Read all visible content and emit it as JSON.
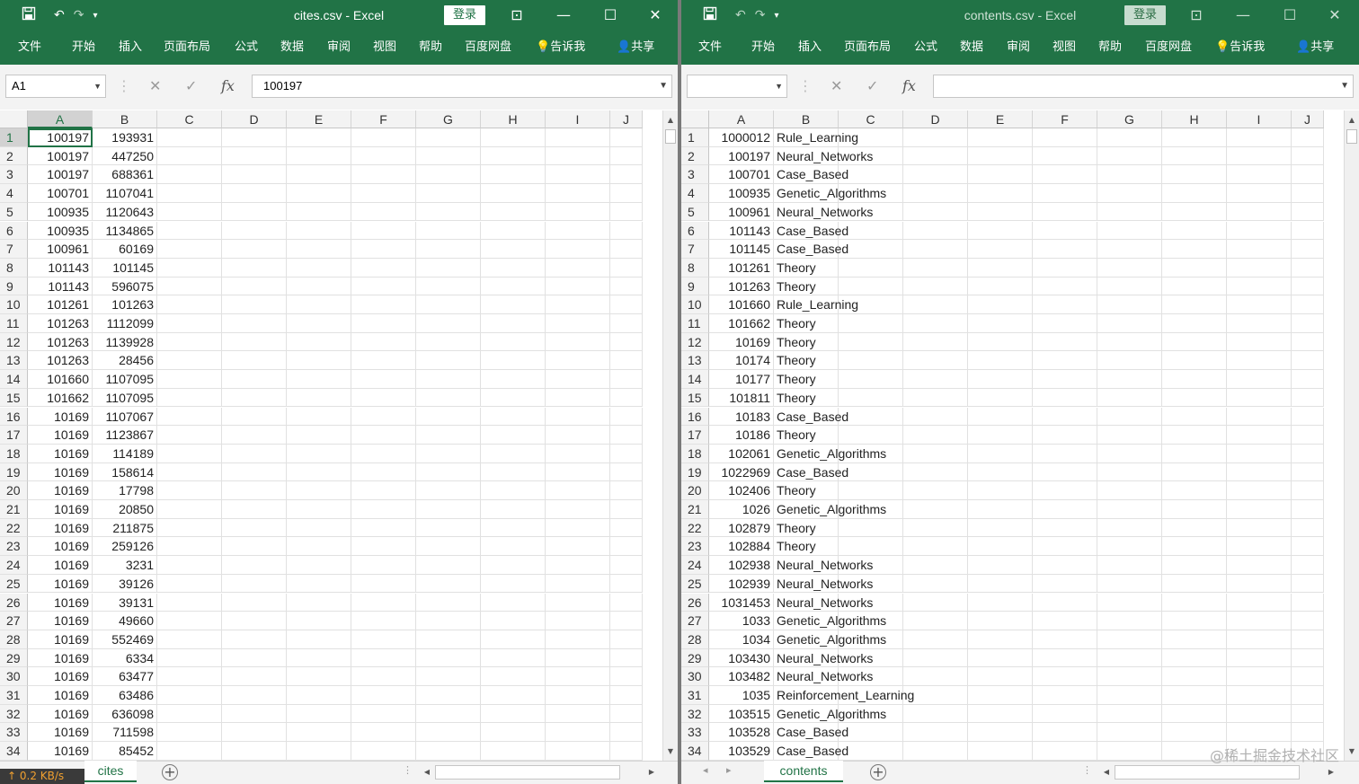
{
  "left": {
    "title": "cites.csv  -  Excel",
    "login_label": "登录",
    "menu": [
      "文件",
      "开始",
      "插入",
      "页面布局",
      "公式",
      "数据",
      "审阅",
      "视图",
      "帮助",
      "百度网盘",
      "告诉我",
      "共享"
    ],
    "name_box": "A1",
    "formula_value": "100197",
    "columns": [
      "A",
      "B",
      "C",
      "D",
      "E",
      "F",
      "G",
      "H",
      "I",
      "J"
    ],
    "rows": [
      {
        "n": "1",
        "a": "100197",
        "b": "193931"
      },
      {
        "n": "2",
        "a": "100197",
        "b": "447250"
      },
      {
        "n": "3",
        "a": "100197",
        "b": "688361"
      },
      {
        "n": "4",
        "a": "100701",
        "b": "1107041"
      },
      {
        "n": "5",
        "a": "100935",
        "b": "1120643"
      },
      {
        "n": "6",
        "a": "100935",
        "b": "1134865"
      },
      {
        "n": "7",
        "a": "100961",
        "b": "60169"
      },
      {
        "n": "8",
        "a": "101143",
        "b": "101145"
      },
      {
        "n": "9",
        "a": "101143",
        "b": "596075"
      },
      {
        "n": "10",
        "a": "101261",
        "b": "101263"
      },
      {
        "n": "11",
        "a": "101263",
        "b": "1112099"
      },
      {
        "n": "12",
        "a": "101263",
        "b": "1139928"
      },
      {
        "n": "13",
        "a": "101263",
        "b": "28456"
      },
      {
        "n": "14",
        "a": "101660",
        "b": "1107095"
      },
      {
        "n": "15",
        "a": "101662",
        "b": "1107095"
      },
      {
        "n": "16",
        "a": "10169",
        "b": "1107067"
      },
      {
        "n": "17",
        "a": "10169",
        "b": "1123867"
      },
      {
        "n": "18",
        "a": "10169",
        "b": "114189"
      },
      {
        "n": "19",
        "a": "10169",
        "b": "158614"
      },
      {
        "n": "20",
        "a": "10169",
        "b": "17798"
      },
      {
        "n": "21",
        "a": "10169",
        "b": "20850"
      },
      {
        "n": "22",
        "a": "10169",
        "b": "211875"
      },
      {
        "n": "23",
        "a": "10169",
        "b": "259126"
      },
      {
        "n": "24",
        "a": "10169",
        "b": "3231"
      },
      {
        "n": "25",
        "a": "10169",
        "b": "39126"
      },
      {
        "n": "26",
        "a": "10169",
        "b": "39131"
      },
      {
        "n": "27",
        "a": "10169",
        "b": "49660"
      },
      {
        "n": "28",
        "a": "10169",
        "b": "552469"
      },
      {
        "n": "29",
        "a": "10169",
        "b": "6334"
      },
      {
        "n": "30",
        "a": "10169",
        "b": "63477"
      },
      {
        "n": "31",
        "a": "10169",
        "b": "63486"
      },
      {
        "n": "32",
        "a": "10169",
        "b": "636098"
      },
      {
        "n": "33",
        "a": "10169",
        "b": "711598"
      },
      {
        "n": "34",
        "a": "10169",
        "b": "85452"
      }
    ],
    "sheet_tab": "cites"
  },
  "right": {
    "title": "contents.csv  -  Excel",
    "login_label": "登录",
    "menu": [
      "文件",
      "开始",
      "插入",
      "页面布局",
      "公式",
      "数据",
      "审阅",
      "视图",
      "帮助",
      "百度网盘",
      "告诉我",
      "共享"
    ],
    "name_box": "",
    "formula_value": "",
    "columns": [
      "A",
      "B",
      "C",
      "D",
      "E",
      "F",
      "G",
      "H",
      "I",
      "J"
    ],
    "rows": [
      {
        "n": "1",
        "a": "1000012",
        "b": "Rule_Learning"
      },
      {
        "n": "2",
        "a": "100197",
        "b": "Neural_Networks"
      },
      {
        "n": "3",
        "a": "100701",
        "b": "Case_Based"
      },
      {
        "n": "4",
        "a": "100935",
        "b": "Genetic_Algorithms"
      },
      {
        "n": "5",
        "a": "100961",
        "b": "Neural_Networks"
      },
      {
        "n": "6",
        "a": "101143",
        "b": "Case_Based"
      },
      {
        "n": "7",
        "a": "101145",
        "b": "Case_Based"
      },
      {
        "n": "8",
        "a": "101261",
        "b": "Theory"
      },
      {
        "n": "9",
        "a": "101263",
        "b": "Theory"
      },
      {
        "n": "10",
        "a": "101660",
        "b": "Rule_Learning"
      },
      {
        "n": "11",
        "a": "101662",
        "b": "Theory"
      },
      {
        "n": "12",
        "a": "10169",
        "b": "Theory"
      },
      {
        "n": "13",
        "a": "10174",
        "b": "Theory"
      },
      {
        "n": "14",
        "a": "10177",
        "b": "Theory"
      },
      {
        "n": "15",
        "a": "101811",
        "b": "Theory"
      },
      {
        "n": "16",
        "a": "10183",
        "b": "Case_Based"
      },
      {
        "n": "17",
        "a": "10186",
        "b": "Theory"
      },
      {
        "n": "18",
        "a": "102061",
        "b": "Genetic_Algorithms"
      },
      {
        "n": "19",
        "a": "1022969",
        "b": "Case_Based"
      },
      {
        "n": "20",
        "a": "102406",
        "b": "Theory"
      },
      {
        "n": "21",
        "a": "1026",
        "b": "Genetic_Algorithms"
      },
      {
        "n": "22",
        "a": "102879",
        "b": "Theory"
      },
      {
        "n": "23",
        "a": "102884",
        "b": "Theory"
      },
      {
        "n": "24",
        "a": "102938",
        "b": "Neural_Networks"
      },
      {
        "n": "25",
        "a": "102939",
        "b": "Neural_Networks"
      },
      {
        "n": "26",
        "a": "1031453",
        "b": "Neural_Networks"
      },
      {
        "n": "27",
        "a": "1033",
        "b": "Genetic_Algorithms"
      },
      {
        "n": "28",
        "a": "1034",
        "b": "Genetic_Algorithms"
      },
      {
        "n": "29",
        "a": "103430",
        "b": "Neural_Networks"
      },
      {
        "n": "30",
        "a": "103482",
        "b": "Neural_Networks"
      },
      {
        "n": "31",
        "a": "1035",
        "b": "Reinforcement_Learning"
      },
      {
        "n": "32",
        "a": "103515",
        "b": "Genetic_Algorithms"
      },
      {
        "n": "33",
        "a": "103528",
        "b": "Case_Based"
      },
      {
        "n": "34",
        "a": "103529",
        "b": "Case_Based"
      }
    ],
    "sheet_tab": "contents"
  },
  "status": {
    "network_speed": "↑ 0.2 KB/s",
    "watermark": "@稀土掘金技术社区"
  },
  "icons": {
    "save": "save-icon",
    "undo": "undo-icon",
    "redo": "redo-icon",
    "lightbulb": "lightbulb-icon",
    "person": "person-icon"
  },
  "colors": {
    "excel_green": "#217346",
    "header_gray": "#f3f3f3",
    "grid_line": "#e1e1e1"
  }
}
